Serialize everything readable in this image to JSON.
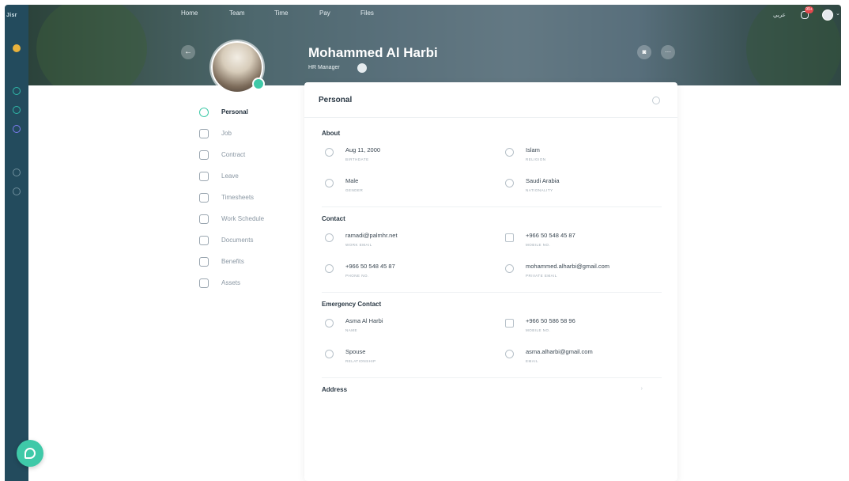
{
  "app": {
    "logo": "Jisr"
  },
  "top_nav": [
    "Home",
    "Team",
    "Time",
    "Pay",
    "Files"
  ],
  "header": {
    "language": "عربي",
    "notification_count": "99+",
    "name": "Mohammed Al Harbi",
    "role": "HR Manager"
  },
  "side_menu": [
    {
      "label": "Personal",
      "icon": "person-icon",
      "active": true
    },
    {
      "label": "Job",
      "icon": "briefcase-icon",
      "active": false
    },
    {
      "label": "Contract",
      "icon": "contract-icon",
      "active": false
    },
    {
      "label": "Leave",
      "icon": "clock-icon",
      "active": false
    },
    {
      "label": "Timesheets",
      "icon": "calendar-icon",
      "active": false
    },
    {
      "label": "Work Schedule",
      "icon": "schedule-icon",
      "active": false
    },
    {
      "label": "Documents",
      "icon": "document-icon",
      "active": false
    },
    {
      "label": "Benefits",
      "icon": "star-icon",
      "active": false
    },
    {
      "label": "Assets",
      "icon": "laptop-icon",
      "active": false
    }
  ],
  "card": {
    "title": "Personal",
    "sections": [
      {
        "title": "About",
        "fields": [
          {
            "value": "Aug 11, 2000",
            "label": "Birthdate",
            "icon": "cake-icon"
          },
          {
            "value": "Islam",
            "label": "Religion",
            "icon": "religion-icon"
          },
          {
            "value": "Male",
            "label": "Gender",
            "icon": "gender-icon"
          },
          {
            "value": "Saudi Arabia",
            "label": "Nationality",
            "icon": "location-icon"
          }
        ]
      },
      {
        "title": "Contact",
        "fields": [
          {
            "value": "ramadi@palmhr.net",
            "label": "Work email",
            "icon": "at-icon"
          },
          {
            "value": "+966 50 548 45 87",
            "label": "Mobile no.",
            "icon": "mobile-icon"
          },
          {
            "value": "+966 50 548 45 87",
            "label": "Phone no.",
            "icon": "phone-icon"
          },
          {
            "value": "mohammed.alharbi@gmail.com",
            "label": "Private email",
            "icon": "at-icon"
          }
        ]
      },
      {
        "title": "Emergency Contact",
        "fields": [
          {
            "value": "Asma Al Harbi",
            "label": "Name",
            "icon": "person-circle-icon"
          },
          {
            "value": "+966 50 586 58 96",
            "label": "Mobile no.",
            "icon": "mobile-icon"
          },
          {
            "value": "Spouse",
            "label": "Relationship",
            "icon": "link-icon"
          },
          {
            "value": "asma.alharbi@gmail.com",
            "label": "Email",
            "icon": "at-icon"
          }
        ]
      }
    ],
    "address_title": "Address"
  },
  "colors": {
    "accent": "#3fc9a8",
    "rail": "#234b5d",
    "notification": "#e5484d"
  }
}
